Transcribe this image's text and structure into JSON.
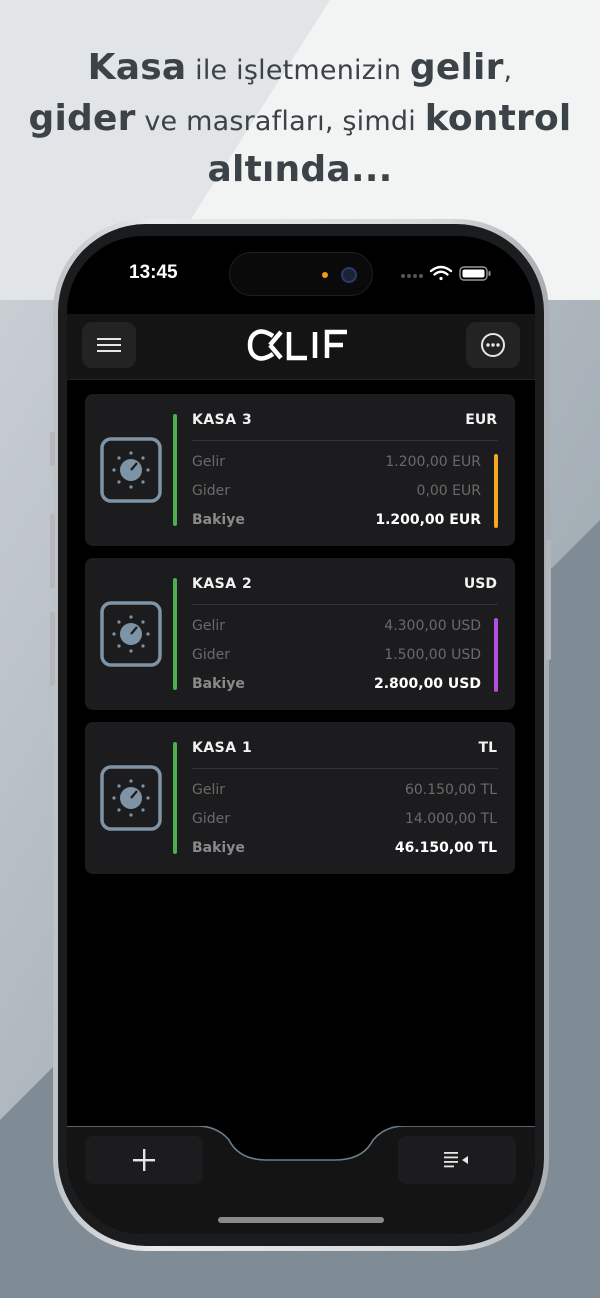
{
  "headline": {
    "l1_a": "Kasa",
    "l1_b": " ile işletmenizin ",
    "l1_c": "gelir",
    "l1_d": ",",
    "l2_a": "gider",
    "l2_b": " ve masrafları, şimdi ",
    "l2_c": "kontrol",
    "l3": "altında..."
  },
  "status": {
    "time": "13:45"
  },
  "header": {
    "logo_text": "OKLIF",
    "menu_icon": "hamburger-icon",
    "more_icon": "ellipsis-circle-icon"
  },
  "labels": {
    "income": "Gelir",
    "expense": "Gider",
    "balance": "Bakiye"
  },
  "cards": [
    {
      "name": "KASA 3",
      "currency": "EUR",
      "income": "1.200,00 EUR",
      "expense": "0,00 EUR",
      "balance": "1.200,00 EUR",
      "accent": "#f5a623"
    },
    {
      "name": "KASA 2",
      "currency": "USD",
      "income": "4.300,00 USD",
      "expense": "1.500,00 USD",
      "balance": "2.800,00 USD",
      "accent": "#b44de0"
    },
    {
      "name": "KASA 1",
      "currency": "TL",
      "income": "60.150,00 TL",
      "expense": "14.000,00 TL",
      "balance": "46.150,00 TL",
      "accent": null
    }
  ],
  "toolbar": {
    "add_icon": "plus-icon",
    "list_icon": "list-filter-icon"
  },
  "colors": {
    "bar_green": "#4caf50",
    "safe_icon": "#7e93a5",
    "background_slate": "#a4aeb6"
  }
}
